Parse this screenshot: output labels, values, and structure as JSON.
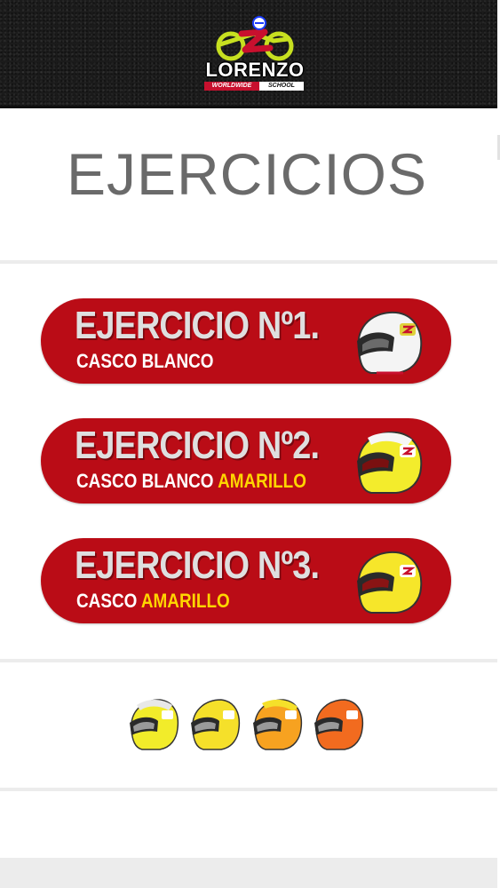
{
  "brand": {
    "name": "LORENZO",
    "sub_left": "WORLDWIDE",
    "sub_right": "SCHOOL"
  },
  "page": {
    "title": "EJERCICIOS"
  },
  "exercises": [
    {
      "title": "EJERCICIO Nº1.",
      "sub_white": "CASCO BLANCO",
      "sub_yellow": "",
      "helmet": "white-helmet-icon"
    },
    {
      "title": "EJERCICIO Nº2.",
      "sub_white": "CASCO BLANCO",
      "sub_yellow": "AMARILLO",
      "helmet": "white-yellow-helmet-icon"
    },
    {
      "title": "EJERCICIO Nº3.",
      "sub_white": "CASCO",
      "sub_yellow": "AMARILLO",
      "helmet": "yellow-helmet-icon"
    }
  ],
  "helmet_levels": [
    {
      "icon": "white-yellow-helmet-icon",
      "color": "#f2ec2a"
    },
    {
      "icon": "yellow-helmet-icon",
      "color": "#f5e02a"
    },
    {
      "icon": "orange-yellow-helmet-icon",
      "color": "#f7a220"
    },
    {
      "icon": "orange-helmet-icon",
      "color": "#f26b1f"
    }
  ],
  "colors": {
    "button_red": "#ba0c16",
    "accent_yellow": "#ffd500",
    "title_gray": "#6a6a6a"
  }
}
